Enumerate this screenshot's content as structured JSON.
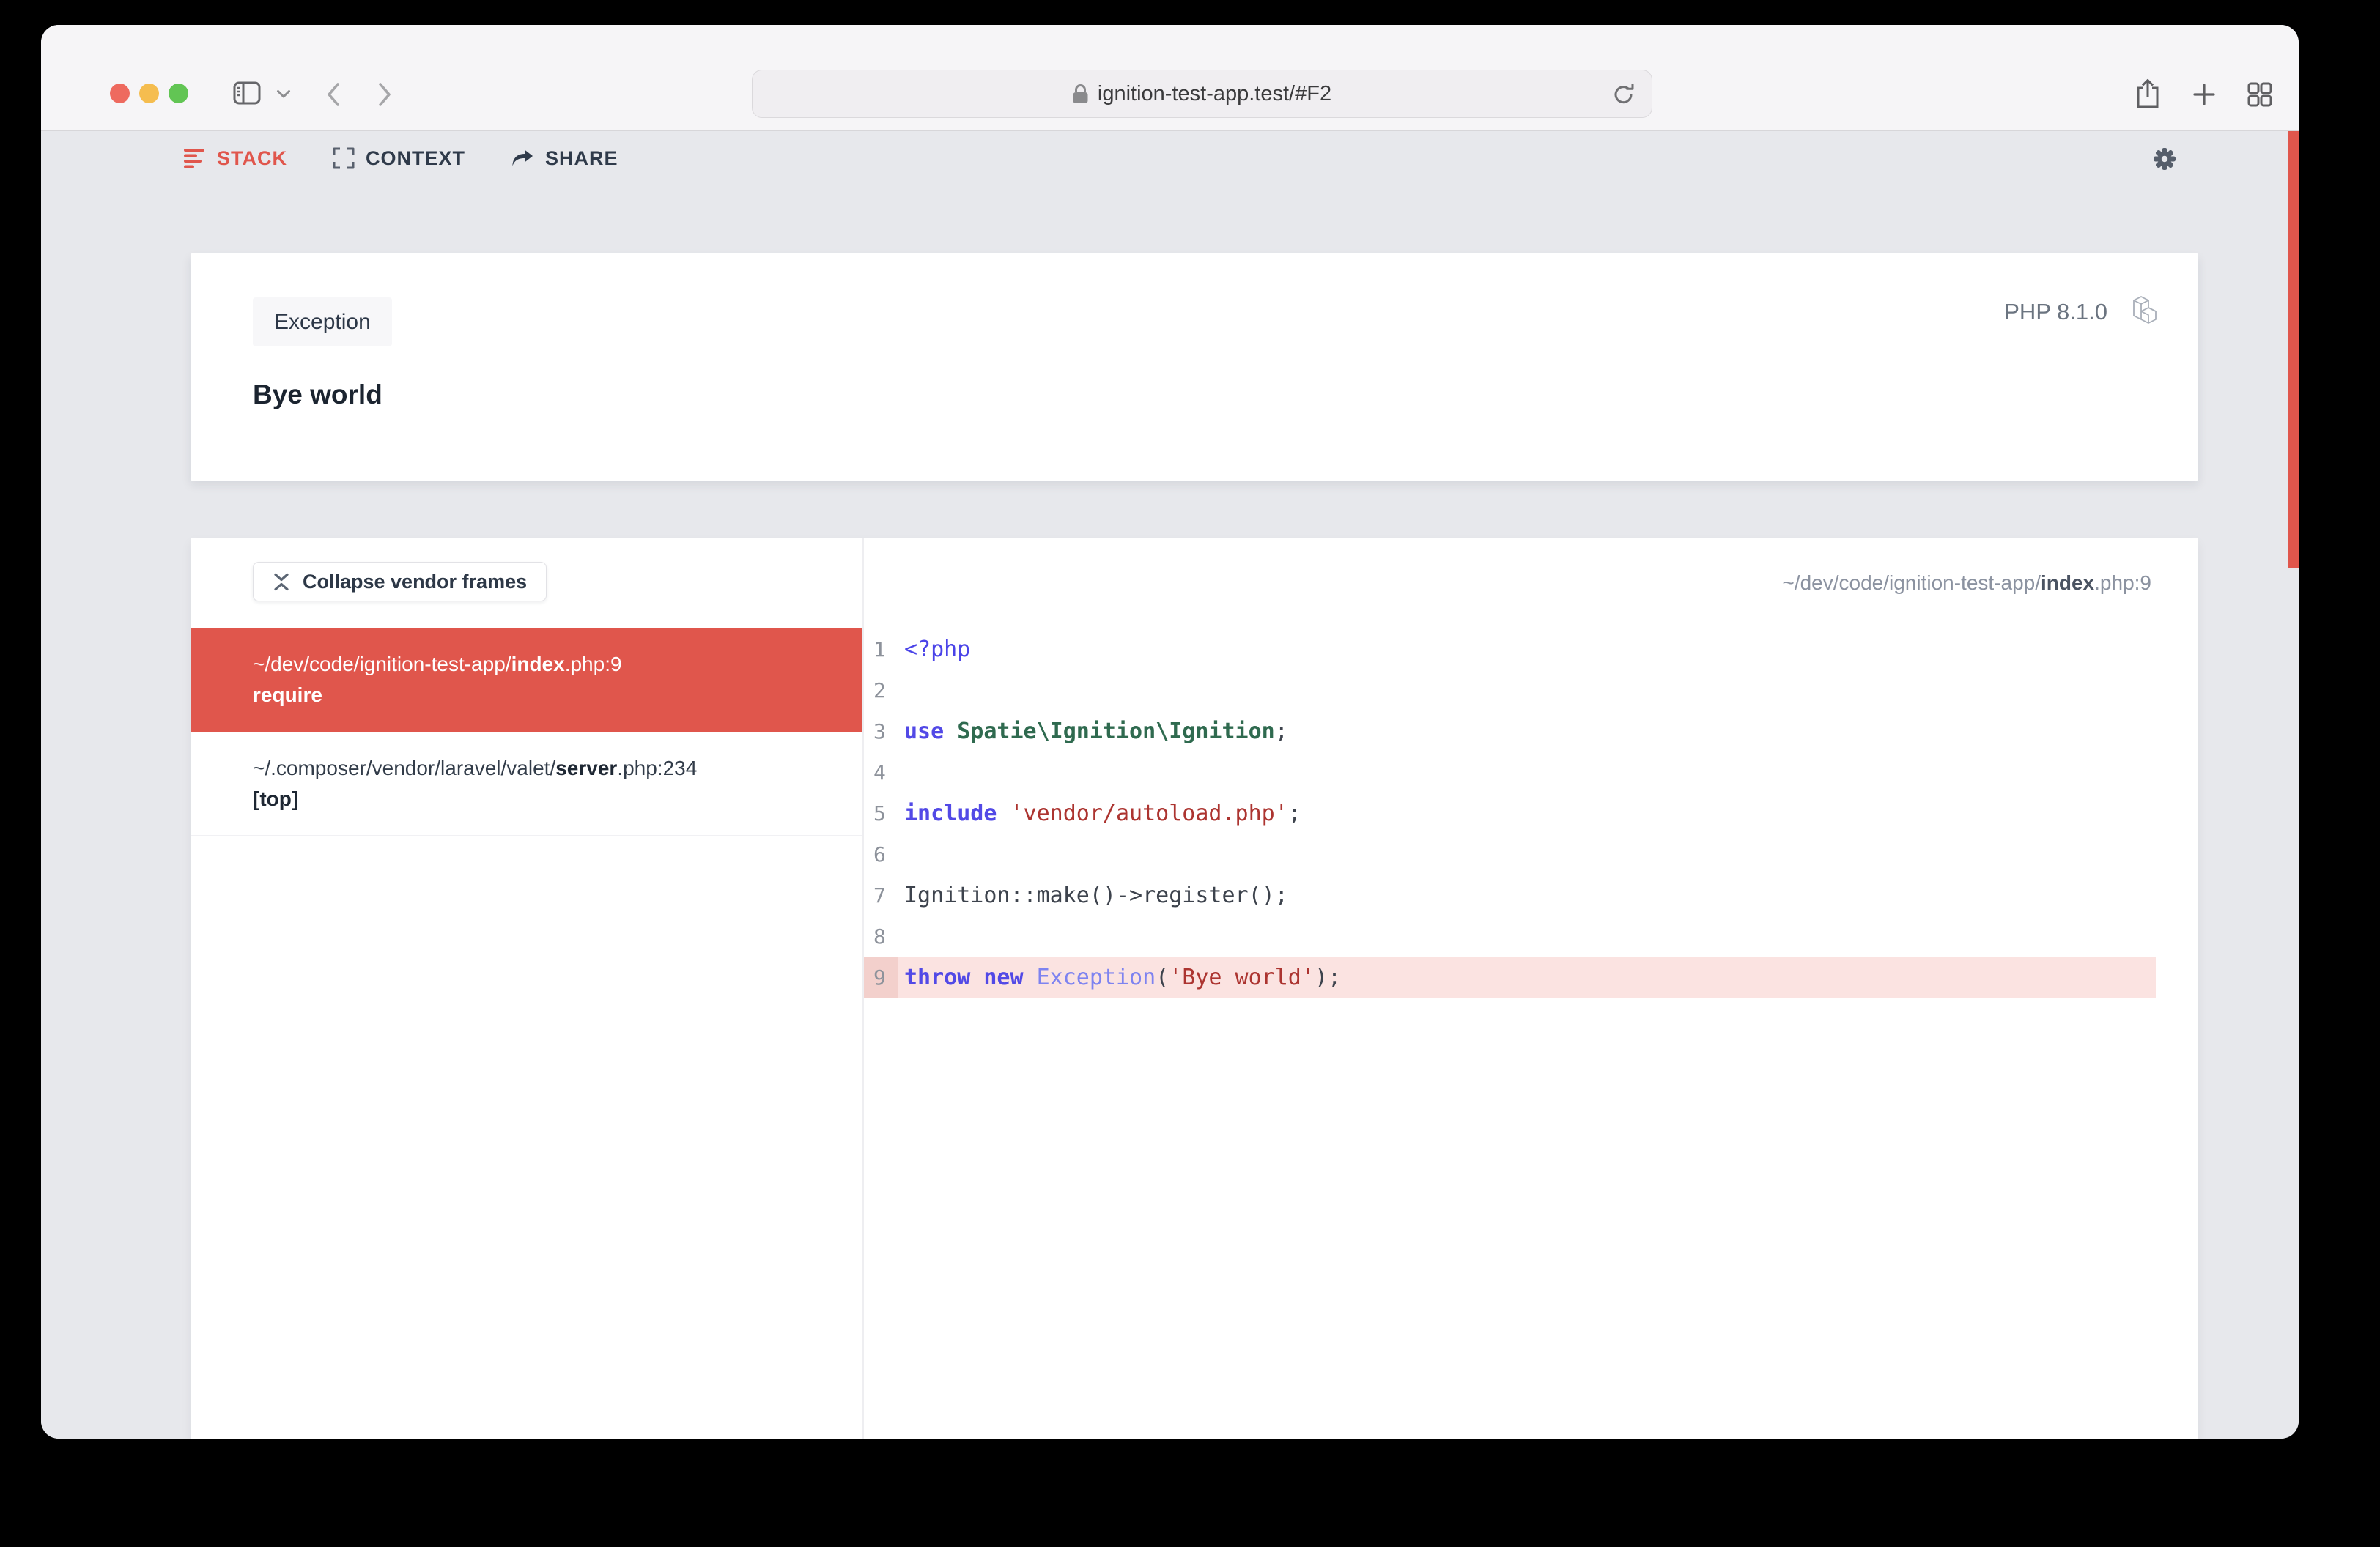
{
  "theme": {
    "accent_red": "#e0564c",
    "page_bg": "#e7e8ec",
    "toolbar_bg": "#f6f5f7",
    "panel_bg": "#ffffff",
    "highlight_line_bg": "#fbe3e1",
    "highlight_gutter_bg": "#f3d0cc",
    "keyword_color": "#5249e6",
    "class_color": "#2f6a4f",
    "string_color": "#ac3430"
  },
  "browser": {
    "url": "ignition-test-app.test/#F2",
    "toolbar_icons": [
      "sidebar-icon",
      "chevron-down-icon",
      "back-icon",
      "forward-icon",
      "lock-icon",
      "reload-icon",
      "share-icon",
      "new-tab-icon",
      "tab-overview-icon"
    ]
  },
  "nav": {
    "items": [
      {
        "label": "STACK",
        "active": true
      },
      {
        "label": "CONTEXT",
        "active": false
      },
      {
        "label": "SHARE",
        "active": false
      }
    ],
    "settings_icon": "gear-icon"
  },
  "error_card": {
    "badge": "Exception",
    "message": "Bye world",
    "php_version": "PHP 8.1.0",
    "framework_icon": "laravel-icon"
  },
  "stack_panel": {
    "collapse_button_label": "Collapse vendor frames",
    "frames": [
      {
        "prefix": "~/dev/code/ignition-test-app/",
        "file": "index",
        "suffix": ".php:9",
        "method": "require",
        "selected": true
      },
      {
        "prefix": "~/.composer/vendor/laravel/valet/",
        "file": "server",
        "suffix": ".php:234",
        "method": "[top]",
        "selected": false
      }
    ]
  },
  "code_panel": {
    "file_header": {
      "prefix": "~/dev/code/ignition-test-app/",
      "file": "index",
      "suffix": ".php:9"
    },
    "highlighted_line": 9,
    "lines": [
      {
        "n": 1,
        "tokens": [
          {
            "c": "phptag",
            "s": "<?php"
          }
        ]
      },
      {
        "n": 2,
        "tokens": []
      },
      {
        "n": 3,
        "tokens": [
          {
            "c": "kw",
            "s": "use"
          },
          {
            "c": "plain",
            "s": " "
          },
          {
            "c": "cls",
            "s": "Spatie\\Ignition\\Ignition"
          },
          {
            "c": "plain",
            "s": ";"
          }
        ]
      },
      {
        "n": 4,
        "tokens": []
      },
      {
        "n": 5,
        "tokens": [
          {
            "c": "kw",
            "s": "include"
          },
          {
            "c": "plain",
            "s": " "
          },
          {
            "c": "str",
            "s": "'vendor/autoload.php'"
          },
          {
            "c": "plain",
            "s": ";"
          }
        ]
      },
      {
        "n": 6,
        "tokens": []
      },
      {
        "n": 7,
        "tokens": [
          {
            "c": "plain",
            "s": "Ignition::make()->register();"
          }
        ]
      },
      {
        "n": 8,
        "tokens": []
      },
      {
        "n": 9,
        "tokens": [
          {
            "c": "kw",
            "s": "throw"
          },
          {
            "c": "plain",
            "s": " "
          },
          {
            "c": "kw",
            "s": "new"
          },
          {
            "c": "plain",
            "s": " "
          },
          {
            "c": "cls2",
            "s": "Exception"
          },
          {
            "c": "plain",
            "s": "("
          },
          {
            "c": "str",
            "s": "'Bye world'"
          },
          {
            "c": "plain",
            "s": ");"
          }
        ]
      }
    ]
  }
}
